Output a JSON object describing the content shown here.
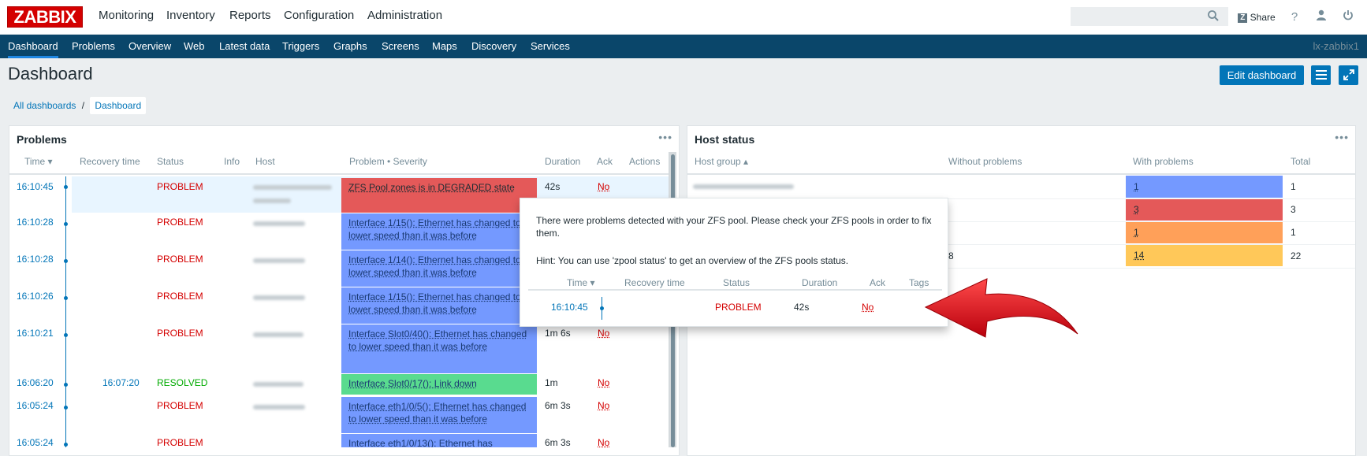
{
  "logo": "ZABBIX",
  "main_menu": [
    "Monitoring",
    "Inventory",
    "Reports",
    "Configuration",
    "Administration"
  ],
  "top_right": {
    "share": "Share",
    "help": "?"
  },
  "sub_menu": [
    "Dashboard",
    "Problems",
    "Overview",
    "Web",
    "Latest data",
    "Triggers",
    "Graphs",
    "Screens",
    "Maps",
    "Discovery",
    "Services"
  ],
  "server_name": "lx-zabbix1",
  "page_title": "Dashboard",
  "edit_dashboard": "Edit dashboard",
  "breadcrumb": {
    "all": "All dashboards",
    "sep": "/",
    "current": "Dashboard"
  },
  "problems_widget": {
    "title": "Problems",
    "columns": [
      "Time ▾",
      "Recovery time",
      "Status",
      "Info",
      "Host",
      "Problem • Severity",
      "Duration",
      "Ack",
      "Actions"
    ],
    "rows": [
      {
        "time": "16:10:45",
        "recovery": "",
        "status": "PROBLEM",
        "problem": "ZFS Pool zones is in DEGRADED state",
        "duration": "42s",
        "ack": "No",
        "severity_color": "#e45959"
      },
      {
        "time": "16:10:28",
        "recovery": "",
        "status": "PROBLEM",
        "problem": "Interface 1/15(): Ethernet has changed to lower speed than it was before",
        "duration": "",
        "ack": "",
        "severity_color": "#7499ff"
      },
      {
        "time": "16:10:28",
        "recovery": "",
        "status": "PROBLEM",
        "problem": "Interface 1/14(): Ethernet has changed to lower speed than it was before",
        "duration": "",
        "ack": "",
        "severity_color": "#7499ff"
      },
      {
        "time": "16:10:26",
        "recovery": "",
        "status": "PROBLEM",
        "problem": "Interface 1/15(): Ethernet has changed to lower speed than it was before",
        "duration": "",
        "ack": "",
        "severity_color": "#7499ff"
      },
      {
        "time": "16:10:21",
        "recovery": "",
        "status": "PROBLEM",
        "problem": "Interface Slot0/40(): Ethernet has changed to lower speed than it was before",
        "duration": "1m 6s",
        "ack": "No",
        "severity_color": "#7499ff"
      },
      {
        "time": "16:06:20",
        "recovery": "16:07:20",
        "status": "RESOLVED",
        "problem": "Interface Slot0/17(): Link down",
        "duration": "1m",
        "ack": "No",
        "severity_color": "#59db8f"
      },
      {
        "time": "16:05:24",
        "recovery": "",
        "status": "PROBLEM",
        "problem": "Interface eth1/0/5(): Ethernet has changed to lower speed than it was before",
        "duration": "6m 3s",
        "ack": "No",
        "severity_color": "#7499ff"
      },
      {
        "time": "16:05:24",
        "recovery": "",
        "status": "PROBLEM",
        "problem": "Interface eth1/0/13(): Ethernet has",
        "duration": "6m 3s",
        "ack": "No",
        "severity_color": "#7499ff"
      }
    ]
  },
  "host_status_widget": {
    "title": "Host status",
    "columns": [
      "Host group ▴",
      "Without problems",
      "With problems",
      "Total"
    ],
    "rows": [
      {
        "without": "",
        "with": "1",
        "with_color": "#7499ff",
        "total": "1"
      },
      {
        "without": "",
        "with": "3",
        "with_color": "#e45959",
        "total": "3"
      },
      {
        "without": "",
        "with": "1",
        "with_color": "#ffa059",
        "total": "1"
      },
      {
        "without": "8",
        "with": "14",
        "with_color": "#ffc859",
        "total": "22"
      }
    ]
  },
  "popup": {
    "message": "There were problems detected with your ZFS pool. Please check your ZFS pools in order to fix them.",
    "hint": "Hint: You can use 'zpool status' to get an overview of the ZFS pools status.",
    "columns": [
      "Time ▾",
      "Recovery time",
      "Status",
      "Duration",
      "Ack",
      "Tags"
    ],
    "row": {
      "time": "16:10:45",
      "recovery": "",
      "status": "PROBLEM",
      "duration": "42s",
      "ack": "No",
      "tags": ""
    }
  },
  "colors": {
    "header_bg": "#0a466a",
    "accent": "#0275b8",
    "problem": "#d40000",
    "resolved": "#00aa00",
    "arrow": "#e0101b"
  }
}
